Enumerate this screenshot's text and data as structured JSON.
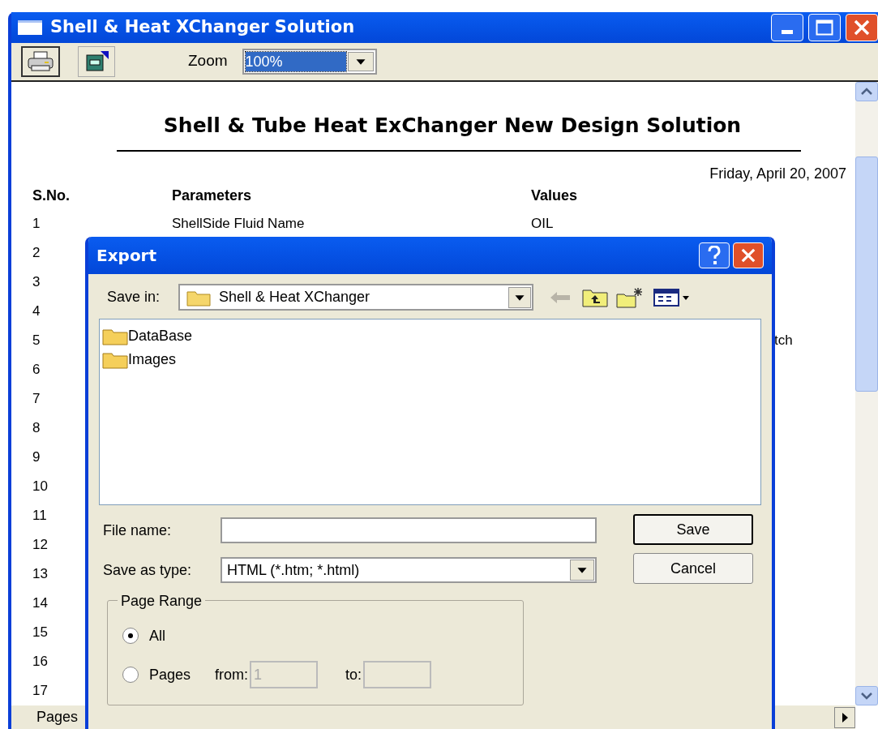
{
  "window": {
    "title": "Shell & Heat XChanger Solution"
  },
  "toolbar": {
    "zoom_label": "Zoom",
    "zoom_value": "100%"
  },
  "report": {
    "title": "Shell & Tube Heat  ExChanger New Design Solution",
    "date": "Friday, April 20, 2007",
    "columns": [
      "S.No.",
      "Parameters",
      "Values"
    ],
    "rows": [
      {
        "s_no": "1",
        "parameter": "ShellSide Fluid Name",
        "value": "OIL"
      },
      {
        "s_no": "2"
      },
      {
        "s_no": "3"
      },
      {
        "s_no": "4"
      },
      {
        "s_no": "5",
        "value": "tch",
        "clipped": true
      },
      {
        "s_no": "6"
      },
      {
        "s_no": "7"
      },
      {
        "s_no": "8"
      },
      {
        "s_no": "9"
      },
      {
        "s_no": "10"
      },
      {
        "s_no": "11"
      },
      {
        "s_no": "12"
      },
      {
        "s_no": "13"
      },
      {
        "s_no": "14"
      },
      {
        "s_no": "15"
      },
      {
        "s_no": "16"
      },
      {
        "s_no": "17"
      }
    ]
  },
  "status_bar": {
    "text": "Pages"
  },
  "dialog": {
    "title": "Export",
    "save_in_label": "Save in:",
    "save_in_value": "Shell & Heat XChanger",
    "files": [
      {
        "name": "DataBase"
      },
      {
        "name": "Images"
      }
    ],
    "file_name_label": "File name:",
    "save_as_type_label": "Save as type:",
    "save_as_type_value": "HTML (*.htm; *.html)",
    "buttons": [
      {
        "label": "Save",
        "default": true
      },
      {
        "label": "Cancel",
        "default": false
      }
    ],
    "page_range": {
      "title": "Page Range",
      "options": [
        {
          "label": "All",
          "selected": true
        },
        {
          "label": "Pages",
          "selected": false
        }
      ],
      "from_label": "from:",
      "from_value": "1",
      "to_label": "to:"
    }
  }
}
